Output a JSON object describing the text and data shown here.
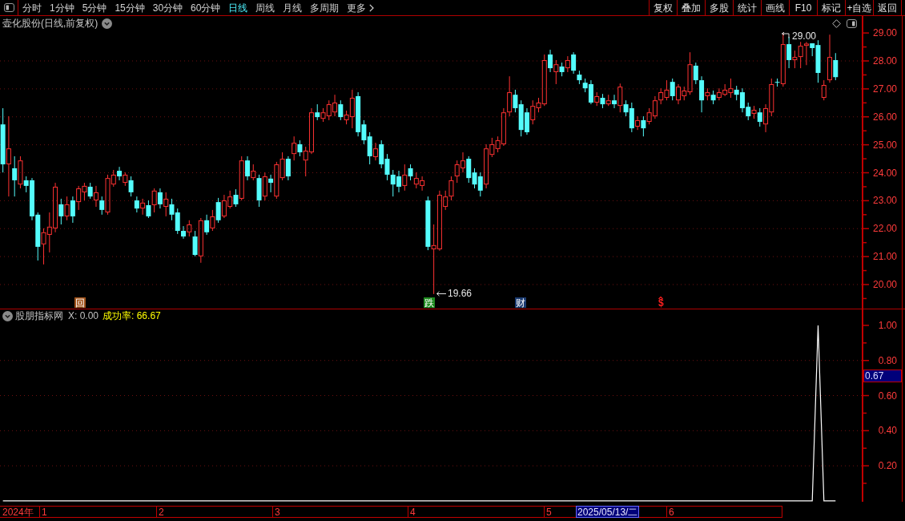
{
  "toolbar": {
    "periods": [
      {
        "label": "分时",
        "selected": false
      },
      {
        "label": "1分钟",
        "selected": false
      },
      {
        "label": "5分钟",
        "selected": false
      },
      {
        "label": "15分钟",
        "selected": false
      },
      {
        "label": "30分钟",
        "selected": false
      },
      {
        "label": "60分钟",
        "selected": false
      },
      {
        "label": "日线",
        "selected": true
      },
      {
        "label": "周线",
        "selected": false
      },
      {
        "label": "月线",
        "selected": false
      },
      {
        "label": "多周期",
        "selected": false
      }
    ],
    "more": "更多",
    "actions": [
      "复权",
      "叠加",
      "多股",
      "统计",
      "画线",
      "F10",
      "标记",
      "+自选",
      "返回"
    ]
  },
  "price_chart": {
    "title": "壶化股份(日线,前复权)",
    "high_label": "29.00",
    "low_label": "19.66",
    "markers": [
      {
        "kind": "tile",
        "text": "回",
        "color": "#a0521a"
      },
      {
        "kind": "tile",
        "text": "跌",
        "color": "#1e8a1e"
      },
      {
        "kind": "tile",
        "text": "财",
        "color": "#1a3a70"
      },
      {
        "kind": "glyph",
        "text": "$",
        "color": "#ff2020"
      }
    ],
    "chart_data": {
      "type": "candlestick",
      "grid": true,
      "categories": [
        null,
        null,
        null,
        null,
        null,
        null,
        null,
        null,
        null,
        null,
        null,
        null,
        null,
        null,
        null,
        null,
        null,
        null,
        null,
        null,
        null,
        null,
        null,
        null,
        null,
        null,
        null,
        null,
        null,
        null,
        null,
        null,
        null,
        null,
        null,
        null,
        null,
        null,
        null,
        null,
        null,
        null,
        null,
        null,
        null,
        null,
        null,
        null,
        null,
        null,
        null,
        null,
        null,
        null,
        null,
        null,
        null,
        null,
        null,
        null,
        null,
        null,
        null,
        null,
        null,
        null,
        null,
        null,
        null,
        null,
        null,
        null,
        null,
        null,
        null,
        null,
        null,
        null,
        null,
        null,
        null,
        null,
        null,
        null,
        null,
        null,
        null,
        null,
        null,
        null,
        null,
        null,
        null,
        null,
        null,
        null,
        null,
        null,
        null,
        null,
        null,
        null,
        null,
        null,
        null,
        null,
        null,
        null,
        null,
        null,
        null,
        null,
        null,
        null,
        null,
        null,
        null,
        null,
        null,
        null,
        null,
        null,
        null,
        null,
        null,
        null,
        null,
        null,
        null,
        null,
        null,
        null,
        null,
        null,
        null,
        null,
        null,
        null,
        null,
        null,
        null,
        null,
        null,
        null,
        null,
        null,
        null,
        null
      ],
      "ylim": [
        19.14,
        29.09
      ],
      "yticks": [
        {
          "value": 29,
          "label": "29.00"
        },
        {
          "value": 28,
          "label": "28.00"
        },
        {
          "value": 27,
          "label": "27.00"
        },
        {
          "value": 26,
          "label": "26.00"
        },
        {
          "value": 25,
          "label": "25.00"
        },
        {
          "value": 24,
          "label": "24.00"
        },
        {
          "value": 23,
          "label": "23.00"
        },
        {
          "value": 22,
          "label": "22.00"
        },
        {
          "value": 21,
          "label": "21.00"
        },
        {
          "value": 20,
          "label": "20.00"
        }
      ],
      "ohlc": [
        [
          25.73,
          26.31,
          24.01,
          24.3
        ],
        [
          24.3,
          26.02,
          23.15,
          24.87
        ],
        [
          24.16,
          24.59,
          23.15,
          23.73
        ],
        [
          23.58,
          24.59,
          23.44,
          24.44
        ],
        [
          23.73,
          23.87,
          23.3,
          23.53
        ],
        [
          23.73,
          23.81,
          22.3,
          22.44
        ],
        [
          22.5,
          22.58,
          20.86,
          21.35
        ],
        [
          21.44,
          22.01,
          20.72,
          21.87
        ],
        [
          21.78,
          22.58,
          21.15,
          22.07
        ],
        [
          22.01,
          23.64,
          21.87,
          23.5
        ],
        [
          22.87,
          23.07,
          22.15,
          22.44
        ],
        [
          22.44,
          23.15,
          22.3,
          22.87
        ],
        [
          23.01,
          23.15,
          22.21,
          22.44
        ],
        [
          22.95,
          23.53,
          22.67,
          23.44
        ],
        [
          23.3,
          23.64,
          23.01,
          23.53
        ],
        [
          23.5,
          23.64,
          23.07,
          23.15
        ],
        [
          23.01,
          23.53,
          22.78,
          23.3
        ],
        [
          23.01,
          23.15,
          22.5,
          22.67
        ],
        [
          22.58,
          23.93,
          22.5,
          23.81
        ],
        [
          23.58,
          24.1,
          23.5,
          23.93
        ],
        [
          24.07,
          24.21,
          23.73,
          23.87
        ],
        [
          23.64,
          24.01,
          23.53,
          23.93
        ],
        [
          23.73,
          23.87,
          23.15,
          23.3
        ],
        [
          23.01,
          23.15,
          22.58,
          22.72
        ],
        [
          22.72,
          23.07,
          22.5,
          22.93
        ],
        [
          22.84,
          23.01,
          22.38,
          22.44
        ],
        [
          22.84,
          23.44,
          22.58,
          23.36
        ],
        [
          23.3,
          23.44,
          22.72,
          22.87
        ],
        [
          22.78,
          23.3,
          22.44,
          23.07
        ],
        [
          22.87,
          23.07,
          22.3,
          22.5
        ],
        [
          22.58,
          22.72,
          21.81,
          21.92
        ],
        [
          21.92,
          22.09,
          21.64,
          21.72
        ],
        [
          21.87,
          22.3,
          21.72,
          22.15
        ],
        [
          21.72,
          21.92,
          21.01,
          21.06
        ],
        [
          21.01,
          22.38,
          20.78,
          22.3
        ],
        [
          22.3,
          22.5,
          21.78,
          21.87
        ],
        [
          22.01,
          22.67,
          21.92,
          22.44
        ],
        [
          22.95,
          23.1,
          22.21,
          22.3
        ],
        [
          22.44,
          23.21,
          22.38,
          23.01
        ],
        [
          22.78,
          23.36,
          22.72,
          23.15
        ],
        [
          23.21,
          23.41,
          22.78,
          22.87
        ],
        [
          23.07,
          24.59,
          23.01,
          24.44
        ],
        [
          24.44,
          24.59,
          23.73,
          23.87
        ],
        [
          23.81,
          24.3,
          23.73,
          24.07
        ],
        [
          23.81,
          23.93,
          22.78,
          23.01
        ],
        [
          23.15,
          24.01,
          23.01,
          23.87
        ],
        [
          23.79,
          23.93,
          23.3,
          23.64
        ],
        [
          23.15,
          24.39,
          23.07,
          24.3
        ],
        [
          23.81,
          24.73,
          23.73,
          24.5
        ],
        [
          24.5,
          24.59,
          23.73,
          23.87
        ],
        [
          24.67,
          25.3,
          24.44,
          25.07
        ],
        [
          25.02,
          25.16,
          24.59,
          24.73
        ],
        [
          24.44,
          24.93,
          23.87,
          24.79
        ],
        [
          24.73,
          26.31,
          24.67,
          26.16
        ],
        [
          26.16,
          26.45,
          25.88,
          25.99
        ],
        [
          25.93,
          26.31,
          25.82,
          26.16
        ],
        [
          26.02,
          26.59,
          25.88,
          26.45
        ],
        [
          26.16,
          26.79,
          26.02,
          26.51
        ],
        [
          26.45,
          26.59,
          25.88,
          25.99
        ],
        [
          25.88,
          26.22,
          25.73,
          26.08
        ],
        [
          25.99,
          26.97,
          25.59,
          26.68
        ],
        [
          26.74,
          26.88,
          25.3,
          25.45
        ],
        [
          25.73,
          25.88,
          25.02,
          25.16
        ],
        [
          25.3,
          25.45,
          24.3,
          24.59
        ],
        [
          24.56,
          25.07,
          24.44,
          24.87
        ],
        [
          25.02,
          25.16,
          24.16,
          24.3
        ],
        [
          24.5,
          24.67,
          23.73,
          23.93
        ],
        [
          23.93,
          24.1,
          23.15,
          23.58
        ],
        [
          23.87,
          24.07,
          23.3,
          23.5
        ],
        [
          23.53,
          24.3,
          23.36,
          23.93
        ],
        [
          24.16,
          24.3,
          23.73,
          23.87
        ],
        [
          23.58,
          24.01,
          23.44,
          23.81
        ],
        [
          23.53,
          23.87,
          23.36,
          23.73
        ],
        [
          23.01,
          23.15,
          21.23,
          21.35
        ],
        [
          21.26,
          22.15,
          19.66,
          21.41
        ],
        [
          21.26,
          23.36,
          21.21,
          23.21
        ],
        [
          22.78,
          23.36,
          22.67,
          23.15
        ],
        [
          23.15,
          23.87,
          23.01,
          23.73
        ],
        [
          23.87,
          24.44,
          23.64,
          24.3
        ],
        [
          24.16,
          24.73,
          24.01,
          24.44
        ],
        [
          24.5,
          24.59,
          23.64,
          23.81
        ],
        [
          24.01,
          24.16,
          23.44,
          23.58
        ],
        [
          23.87,
          24.01,
          23.15,
          23.36
        ],
        [
          23.58,
          25.02,
          23.44,
          24.87
        ],
        [
          24.64,
          25.25,
          24.56,
          25.02
        ],
        [
          24.85,
          25.3,
          24.73,
          25.16
        ],
        [
          25.02,
          26.31,
          24.96,
          26.16
        ],
        [
          26.16,
          27.45,
          26.02,
          26.88
        ],
        [
          26.79,
          26.97,
          26.16,
          26.31
        ],
        [
          26.45,
          26.59,
          25.3,
          25.53
        ],
        [
          26.16,
          26.31,
          25.36,
          25.45
        ],
        [
          25.88,
          26.59,
          25.73,
          26.39
        ],
        [
          26.31,
          26.68,
          26.16,
          26.51
        ],
        [
          26.45,
          28.23,
          26.39,
          28.03
        ],
        [
          28.23,
          28.4,
          27.6,
          27.74
        ],
        [
          27.6,
          28.03,
          27.17,
          27.88
        ],
        [
          27.8,
          27.94,
          27.45,
          27.6
        ],
        [
          27.74,
          28.17,
          27.6,
          28.03
        ],
        [
          28.23,
          28.31,
          27.54,
          27.65
        ],
        [
          27.51,
          27.65,
          27.17,
          27.31
        ],
        [
          27.22,
          27.37,
          26.88,
          27.02
        ],
        [
          27.17,
          27.31,
          26.45,
          26.51
        ],
        [
          26.51,
          26.88,
          26.39,
          26.74
        ],
        [
          26.68,
          26.82,
          26.31,
          26.45
        ],
        [
          26.45,
          26.79,
          26.39,
          26.59
        ],
        [
          26.59,
          26.79,
          26.31,
          26.45
        ],
        [
          26.39,
          27.19,
          26.16,
          27.08
        ],
        [
          26.45,
          26.59,
          26.02,
          26.16
        ],
        [
          26.31,
          26.51,
          25.45,
          25.59
        ],
        [
          25.65,
          26.02,
          25.53,
          25.88
        ],
        [
          25.88,
          26.02,
          25.3,
          25.59
        ],
        [
          25.82,
          26.31,
          25.73,
          26.16
        ],
        [
          26.02,
          26.74,
          25.93,
          26.59
        ],
        [
          26.59,
          27.02,
          26.45,
          26.88
        ],
        [
          26.68,
          27.31,
          26.59,
          26.97
        ],
        [
          27.25,
          27.37,
          26.59,
          26.74
        ],
        [
          26.59,
          27.17,
          26.45,
          27.08
        ],
        [
          26.74,
          27.08,
          26.59,
          26.94
        ],
        [
          26.88,
          28.31,
          26.79,
          27.88
        ],
        [
          27.83,
          27.94,
          27.17,
          27.31
        ],
        [
          27.31,
          27.45,
          26.16,
          26.59
        ],
        [
          26.74,
          27.02,
          26.59,
          26.88
        ],
        [
          26.79,
          26.94,
          26.45,
          26.59
        ],
        [
          26.68,
          27.02,
          26.59,
          26.88
        ],
        [
          26.79,
          27.17,
          26.74,
          26.97
        ],
        [
          26.85,
          27.37,
          26.68,
          27.02
        ],
        [
          26.97,
          27.11,
          26.59,
          26.79
        ],
        [
          26.88,
          27.02,
          26.16,
          26.31
        ],
        [
          26.36,
          26.51,
          25.88,
          26.02
        ],
        [
          26.11,
          26.39,
          25.93,
          26.25
        ],
        [
          26.16,
          26.31,
          25.65,
          25.82
        ],
        [
          25.73,
          26.45,
          25.45,
          26.31
        ],
        [
          26.16,
          27.37,
          26.02,
          27.17
        ],
        [
          27.25,
          27.37,
          27.08,
          27.22
        ],
        [
          27.17,
          29.0,
          27.08,
          28.6
        ],
        [
          28.6,
          28.86,
          27.74,
          28.03
        ],
        [
          28.03,
          28.37,
          27.74,
          28.14
        ],
        [
          28.14,
          28.68,
          27.74,
          28.54
        ],
        [
          28.54,
          28.68,
          27.85,
          28.62
        ],
        [
          28.63,
          28.63,
          28.17,
          28.46
        ],
        [
          28.57,
          28.74,
          27.22,
          27.57
        ],
        [
          26.68,
          27.31,
          26.59,
          27.14
        ],
        [
          27.31,
          28.94,
          27.22,
          28.14
        ],
        [
          28.03,
          28.28,
          27.31,
          27.42
        ],
        null,
        null,
        null,
        null
      ]
    }
  },
  "indicator": {
    "name": "股朋指标网",
    "reading": "X: 0.00",
    "success_rate": "成功率: 66.67",
    "current_value": "0.67",
    "chart_data": {
      "type": "line",
      "grid": true,
      "categories": [
        null,
        null,
        null,
        null,
        null,
        null,
        null,
        null,
        null,
        null,
        null,
        null,
        null,
        null,
        null,
        null,
        null,
        null,
        null,
        null,
        null,
        null,
        null,
        null,
        null,
        null,
        null,
        null,
        null,
        null,
        null,
        null,
        null,
        null,
        null,
        null,
        null,
        null,
        null,
        null,
        null,
        null,
        null,
        null,
        null,
        null,
        null,
        null,
        null,
        null,
        null,
        null,
        null,
        null,
        null,
        null,
        null,
        null,
        null,
        null,
        null,
        null,
        null,
        null,
        null,
        null,
        null,
        null,
        null,
        null,
        null,
        null,
        null,
        null,
        null,
        null,
        null,
        null,
        null,
        null,
        null,
        null,
        null,
        null,
        null,
        null,
        null,
        null,
        null,
        null,
        null,
        null,
        null,
        null,
        null,
        null,
        null,
        null,
        null,
        null,
        null,
        null,
        null,
        null,
        null,
        null,
        null,
        null,
        null,
        null,
        null,
        null,
        null,
        null,
        null,
        null,
        null,
        null,
        null,
        null,
        null,
        null,
        null,
        null,
        null,
        null,
        null,
        null,
        null,
        null,
        null,
        null,
        null,
        null,
        null,
        null,
        null,
        null,
        null,
        null,
        null,
        null,
        null,
        null,
        null,
        null,
        null,
        null
      ],
      "ylim": [
        -0.005,
        1.018
      ],
      "yticks": [
        {
          "value": 1,
          "label": "1.00"
        },
        {
          "value": 0.8,
          "label": "0.80"
        },
        {
          "value": 0.6,
          "label": "0.60"
        },
        {
          "value": 0.4,
          "label": "0.40"
        },
        {
          "value": 0.2,
          "label": "0.20"
        }
      ],
      "series": [
        {
          "color": "#ffffff",
          "values": [
            0,
            0,
            0,
            0,
            0,
            0,
            0,
            0,
            0,
            0,
            0,
            0,
            0,
            0,
            0,
            0,
            0,
            0,
            0,
            0,
            0,
            0,
            0,
            0,
            0,
            0,
            0,
            0,
            0,
            0,
            0,
            0,
            0,
            0,
            0,
            0,
            0,
            0,
            0,
            0,
            0,
            0,
            0,
            0,
            0,
            0,
            0,
            0,
            0,
            0,
            0,
            0,
            0,
            0,
            0,
            0,
            0,
            0,
            0,
            0,
            0,
            0,
            0,
            0,
            0,
            0,
            0,
            0,
            0,
            0,
            0,
            0,
            0,
            0,
            0,
            0,
            0,
            0,
            0,
            0,
            0,
            0,
            0,
            0,
            0,
            0,
            0,
            0,
            0,
            0,
            0,
            0,
            0,
            0,
            0,
            0,
            0,
            0,
            0,
            0,
            0,
            0,
            0,
            0,
            0,
            0,
            0,
            0,
            0,
            0,
            0,
            0,
            0,
            0,
            0,
            0,
            0,
            0,
            0,
            0,
            0,
            0,
            0,
            0,
            0,
            0,
            0,
            0,
            0,
            0,
            0,
            0,
            0,
            0,
            0,
            0,
            0,
            0,
            0,
            0,
            1,
            0,
            0,
            0,
            null,
            null,
            null,
            null
          ]
        }
      ]
    }
  },
  "time_axis": {
    "year": "2024年",
    "months": [
      "1",
      "2",
      "3",
      "4",
      "5",
      "6"
    ],
    "cursor_date": "2025/05/13/二"
  }
}
